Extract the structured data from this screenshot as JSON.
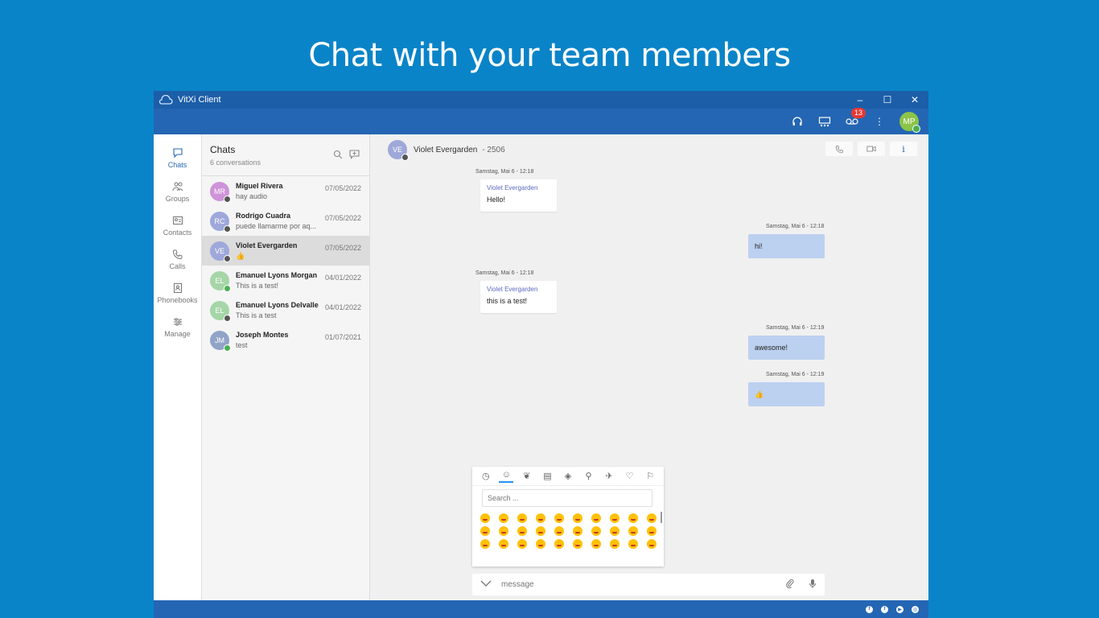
{
  "headline": "Chat with your team members",
  "window": {
    "title": "VitXi Client",
    "controls": {
      "minimize": "–",
      "maximize": "☐",
      "close": "✕"
    }
  },
  "appbar": {
    "badge_count": "13",
    "avatar_initials": "MP",
    "colors": {
      "bar": "#2466b3",
      "titlebar": "#1c5ea8",
      "badge": "#e53935"
    }
  },
  "nav": {
    "items": [
      {
        "label": "Chats",
        "icon": "chat-icon",
        "active": true
      },
      {
        "label": "Groups",
        "icon": "groups-icon"
      },
      {
        "label": "Contacts",
        "icon": "contacts-icon"
      },
      {
        "label": "Calls",
        "icon": "phone-icon"
      },
      {
        "label": "Phonebooks",
        "icon": "phonebook-icon"
      },
      {
        "label": "Manage",
        "icon": "sliders-icon"
      }
    ]
  },
  "chatlist": {
    "title": "Chats",
    "subtitle": "6 conversations",
    "conversations": [
      {
        "initials": "MR",
        "name": "Miguel Rivera",
        "preview": "hay audio",
        "date": "07/05/2022",
        "color": "#ce93d8",
        "status": "#555555"
      },
      {
        "initials": "RC",
        "name": "Rodrigo Cuadra",
        "preview": "puede llamarme por aq...",
        "date": "07/05/2022",
        "color": "#9fa8da",
        "status": "#555555"
      },
      {
        "initials": "VE",
        "name": "Violet Evergarden",
        "preview": "👍",
        "date": "07/05/2022",
        "color": "#9fa8da",
        "status": "#555555",
        "active": true
      },
      {
        "initials": "EL",
        "name": "Emanuel Lyons Morgan",
        "preview": "This is a test!",
        "date": "04/01/2022",
        "color": "#a5d6a7",
        "status": "#4caf50"
      },
      {
        "initials": "EL",
        "name": "Emanuel Lyons Delvalle",
        "preview": "This is a test",
        "date": "04/01/2022",
        "color": "#a5d6a7",
        "status": "#555555"
      },
      {
        "initials": "JM",
        "name": "Joseph Montes",
        "preview": "test",
        "date": "01/07/2021",
        "color": "#90a4c8",
        "status": "#4caf50"
      }
    ]
  },
  "chat": {
    "contact_initials": "VE",
    "contact_name": "Violet Evergarden",
    "contact_ext": "- 2506",
    "messages": [
      {
        "dir": "in",
        "time": "Samstag, Mai 6 - 12:18",
        "sender": "Violet Evergarden",
        "text": "Hello!"
      },
      {
        "dir": "out",
        "time": "Samstag, Mai 6 - 12:18",
        "text": "hi!"
      },
      {
        "dir": "in",
        "time": "Samstag, Mai 6 - 12:18",
        "sender": "Violet Evergarden",
        "text": "this is a test!"
      },
      {
        "dir": "out",
        "time": "Samstag, Mai 6 - 12:19",
        "text": "awesome!"
      },
      {
        "dir": "out",
        "time": "Samstag, Mai 6 - 12:19",
        "text": "👍"
      }
    ],
    "emoji_search_placeholder": "Search ...",
    "composer_placeholder": "message",
    "colors": {
      "bubble_out": "#bcd0f0",
      "sender": "#5c6bc0"
    }
  },
  "footer": {
    "social": [
      "f",
      "t",
      "▶",
      "◎"
    ]
  }
}
